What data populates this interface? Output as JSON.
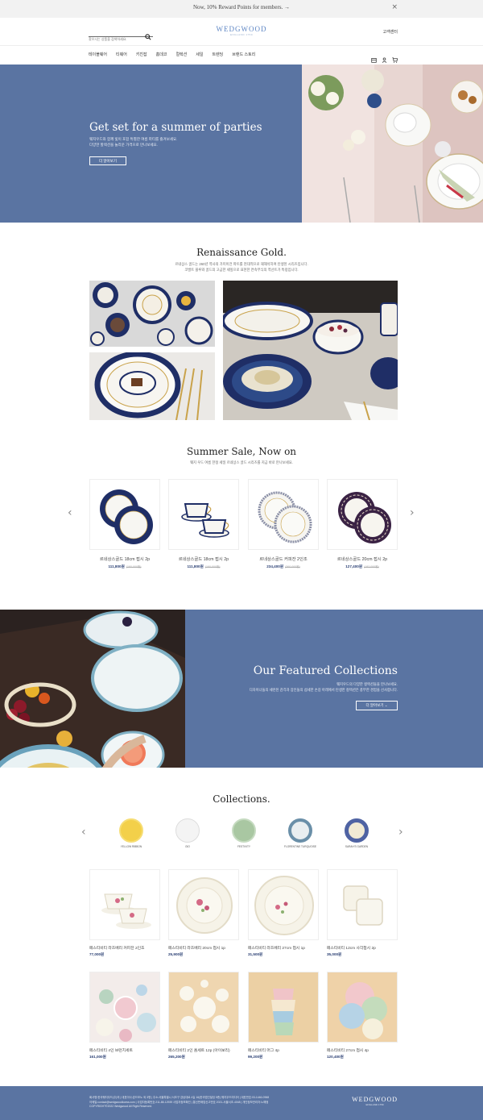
{
  "promo": {
    "text": "Now, 10% Reward Points for members.  →",
    "close": "×"
  },
  "header": {
    "search_placeholder": "찾으시는 상품을 검색하세요.",
    "logo": "WEDGWOOD",
    "logo_sub": "ENGLAND 1759",
    "customer_center": "고객센터",
    "nav": [
      "테이블웨어",
      "티웨어",
      "키친잡",
      "홈데코",
      "컬렉션",
      "세일",
      "트렌딩",
      "브랜드 스토리"
    ]
  },
  "hero": {
    "title": "Get set for a summer of parties",
    "desc1": "웨지우드와 함께 빛이 포함 특별한 여름 파티를 즐겨보세요.",
    "desc2": "다양한 할렉션을 놀라운 가격으로 만나보세요.",
    "button": "더 알아보기"
  },
  "renaissance": {
    "title": "Renaissance Gold.",
    "desc1": "르네상스 골드는 260년 역사의 가미이전 파트를 현대적으로 재해석하여 탄생된 시리즈입니다.",
    "desc2": "코발트 블루와 골드의 고급한 세잎으로 표현한 연속무늬의 역선트가 특징입니다."
  },
  "sale": {
    "title": "Summer Sale, Now on",
    "desc": "웨지 우드 여름 한정 세일 르네상스 골드 시리즈를 지금 바로 만나보세요.",
    "products": [
      {
        "name": "르네상스골드 18cm 접시 2p",
        "price": "111,800원",
        "orig": "(160,000원)"
      },
      {
        "name": "르네상스골드 18cm 접시 2p",
        "price": "111,800원",
        "orig": "(160,000원)"
      },
      {
        "name": "르네상스골드 커피잔 2인조",
        "price": "234,400원",
        "orig": "(360,000원)"
      },
      {
        "name": "르네상스골드 20cm 접시 2p",
        "price": "127,400원",
        "orig": "(182,000원)"
      }
    ]
  },
  "featured": {
    "title": "Our Featured Collections",
    "desc1": "웨지우드의 다양한 컬렉션들을 만나보세요.",
    "desc2": "디자이너들의 세련된 감각과 장인들의 섬세한 손길 아래에서 탄생한 컬렉션은 풍부한 경험을 선사합니다.",
    "button": "더 알아보기 ⌄"
  },
  "collections": {
    "title": "Collections.",
    "items": [
      {
        "name": "YELLOW RIBBON",
        "color": "#f3d04a"
      },
      {
        "name": "GIO",
        "color": "#f4f4f4"
      },
      {
        "name": "FESTIVITY",
        "color": "#a9c7a2"
      },
      {
        "name": "FLORENTINE TURQUOISE",
        "color": "#6a8fa8"
      },
      {
        "name": "SARAH'S GARDEN",
        "color": "#4f63a3"
      }
    ],
    "products": [
      {
        "name": "페스티비티 라즈베리 커피잔 2인조",
        "price": "77,000원"
      },
      {
        "name": "페스티비티 라즈베리 20cm 접시 1p",
        "price": "25,900원"
      },
      {
        "name": "페스티비티 라즈베리 27cm 접시 1p",
        "price": "31,500원"
      },
      {
        "name": "페스티비티 12cm 사각접시 2p",
        "price": "35,000원"
      },
      {
        "name": "페스티비티 4인 브런치세트",
        "price": "161,000원"
      },
      {
        "name": "페스티비티 2인 홈세트 12p (아이보리)",
        "price": "265,200원"
      },
      {
        "name": "페스티비티 머그 4p",
        "price": "99,200원"
      },
      {
        "name": "페스티비티 27cm 접시 4p",
        "price": "120,400원"
      }
    ]
  },
  "footer": {
    "line1": "회사명:한국웨지우드(주)의 | 대표이사:존드모노 외 3명 | 주소:서울특별시 서초구 강남대로 4길 16(한국법인빌딩 5층) 웨지우드미디어 | 대표번호:03-1446-0968",
    "line2": "이메일:contact@wedgwoodkorea.com | 사업자등록번호:211-88-12939 사업자정보확인 | 통신판매업신고번호 2021-서울서초-4048 | 개인정보관리자:노해정",
    "line3": "COPYRIGHT©2022 Wedgwood All Right Reserved.",
    "logo": "WEDGWOOD",
    "logo_sub": "ENGLAND 1759"
  }
}
